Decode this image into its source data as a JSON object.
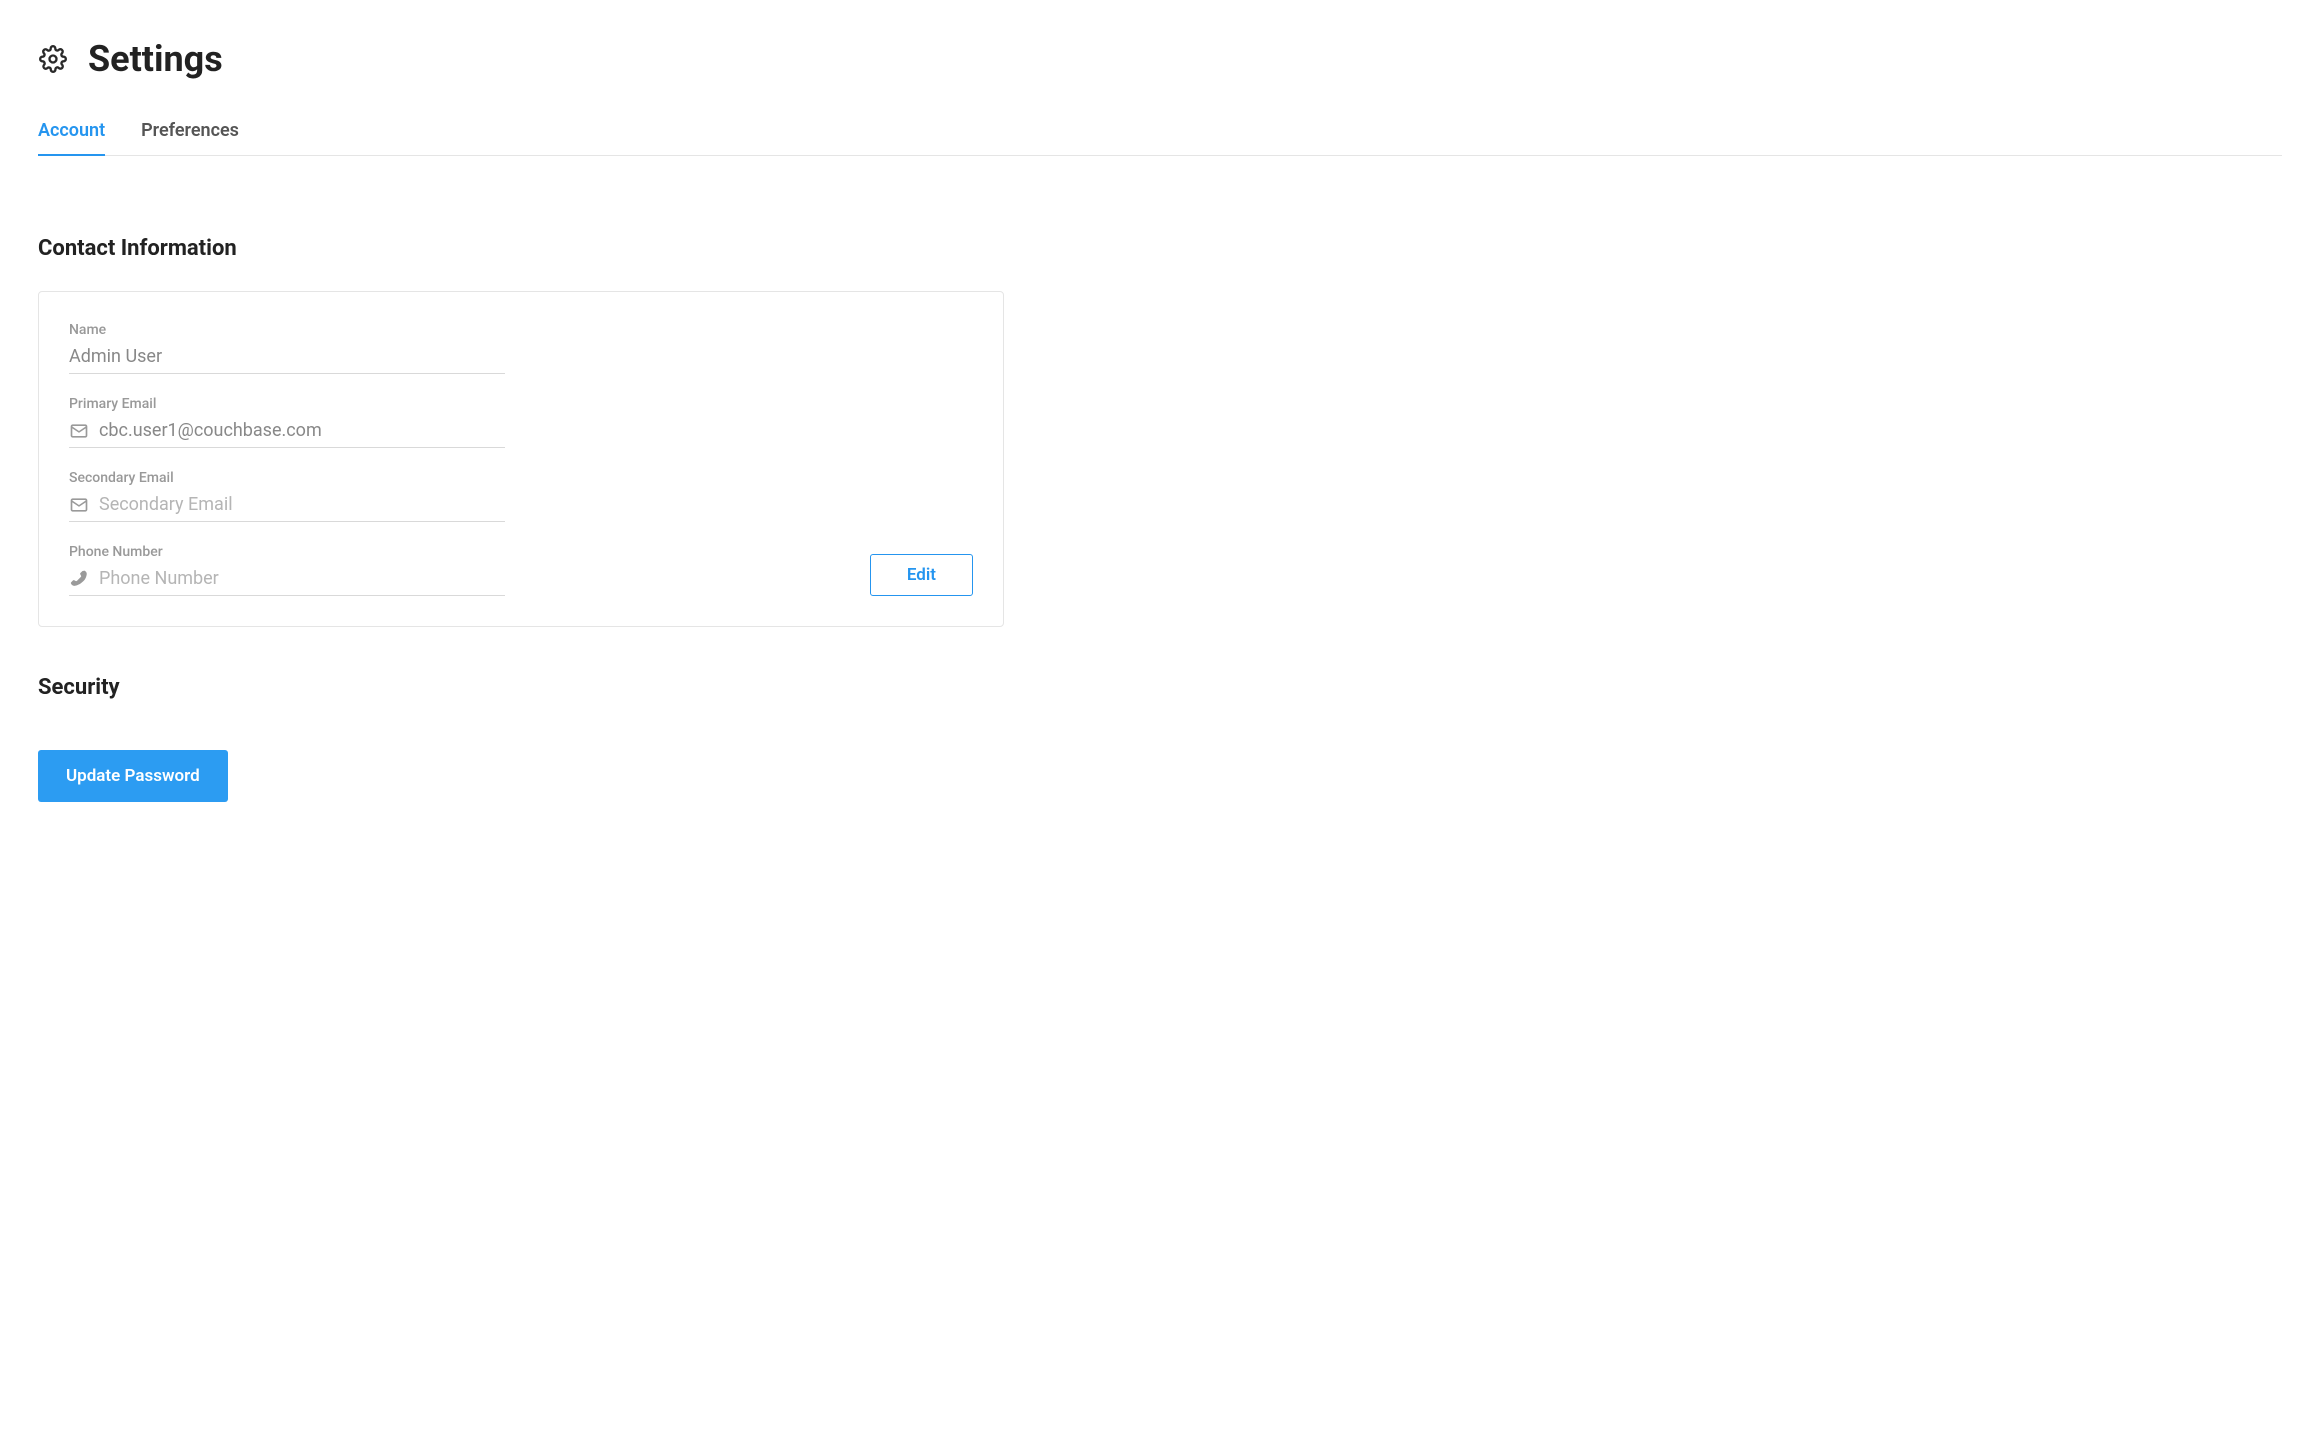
{
  "header": {
    "title": "Settings"
  },
  "tabs": {
    "account": "Account",
    "preferences": "Preferences"
  },
  "contact": {
    "heading": "Contact Information",
    "name_label": "Name",
    "name_value": "Admin User",
    "primary_email_label": "Primary Email",
    "primary_email_value": "cbc.user1@couchbase.com",
    "secondary_email_label": "Secondary Email",
    "secondary_email_placeholder": "Secondary Email",
    "secondary_email_value": "",
    "phone_label": "Phone Number",
    "phone_placeholder": "Phone Number",
    "phone_value": "",
    "edit_label": "Edit"
  },
  "security": {
    "heading": "Security",
    "update_password_label": "Update Password"
  }
}
